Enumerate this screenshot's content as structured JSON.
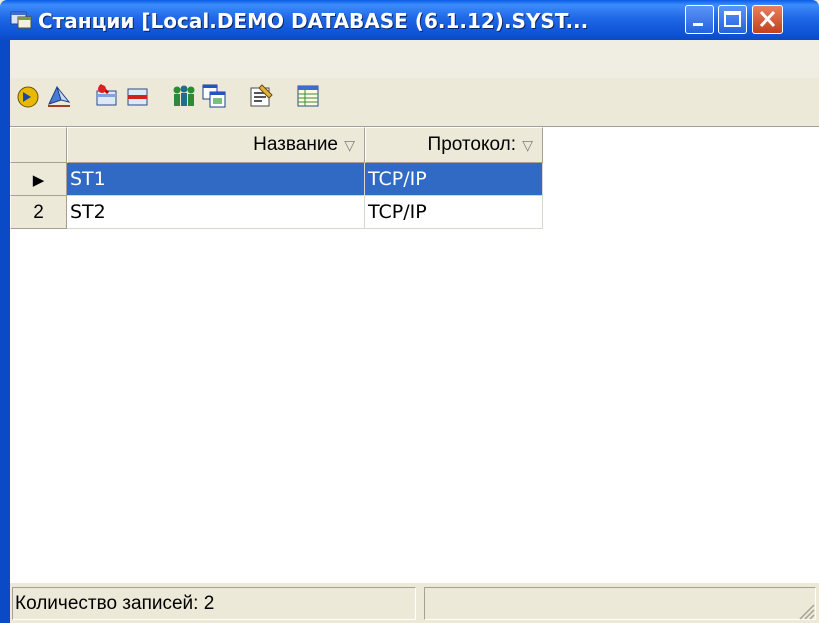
{
  "window": {
    "title": "Станции [Local.DEMO DATABASE (6.1.12).SYST...",
    "controls": {
      "minimize": "minimize",
      "maximize": "maximize",
      "close": "close"
    }
  },
  "toolbar": {
    "tools": [
      "refresh-icon",
      "tray-icon",
      "add-record-icon",
      "delete-record-icon",
      "users-icon",
      "window-list-icon",
      "properties-icon",
      "table-icon"
    ]
  },
  "grid": {
    "columns": [
      {
        "label": "Название",
        "sort_glyph": "▽"
      },
      {
        "label": "Протокол:",
        "sort_glyph": "▽"
      }
    ],
    "rows": [
      {
        "indicator": "▶",
        "name": "ST1",
        "protocol": "TCP/IP",
        "selected": true
      },
      {
        "indicator": "2",
        "name": "ST2",
        "protocol": "TCP/IP",
        "selected": false
      }
    ]
  },
  "status": {
    "record_count": "Количество записей: 2",
    "panel2": ""
  },
  "colors": {
    "selection": "#316ac5",
    "titlebar": "#0f55d8",
    "chrome": "#ece9d8"
  }
}
